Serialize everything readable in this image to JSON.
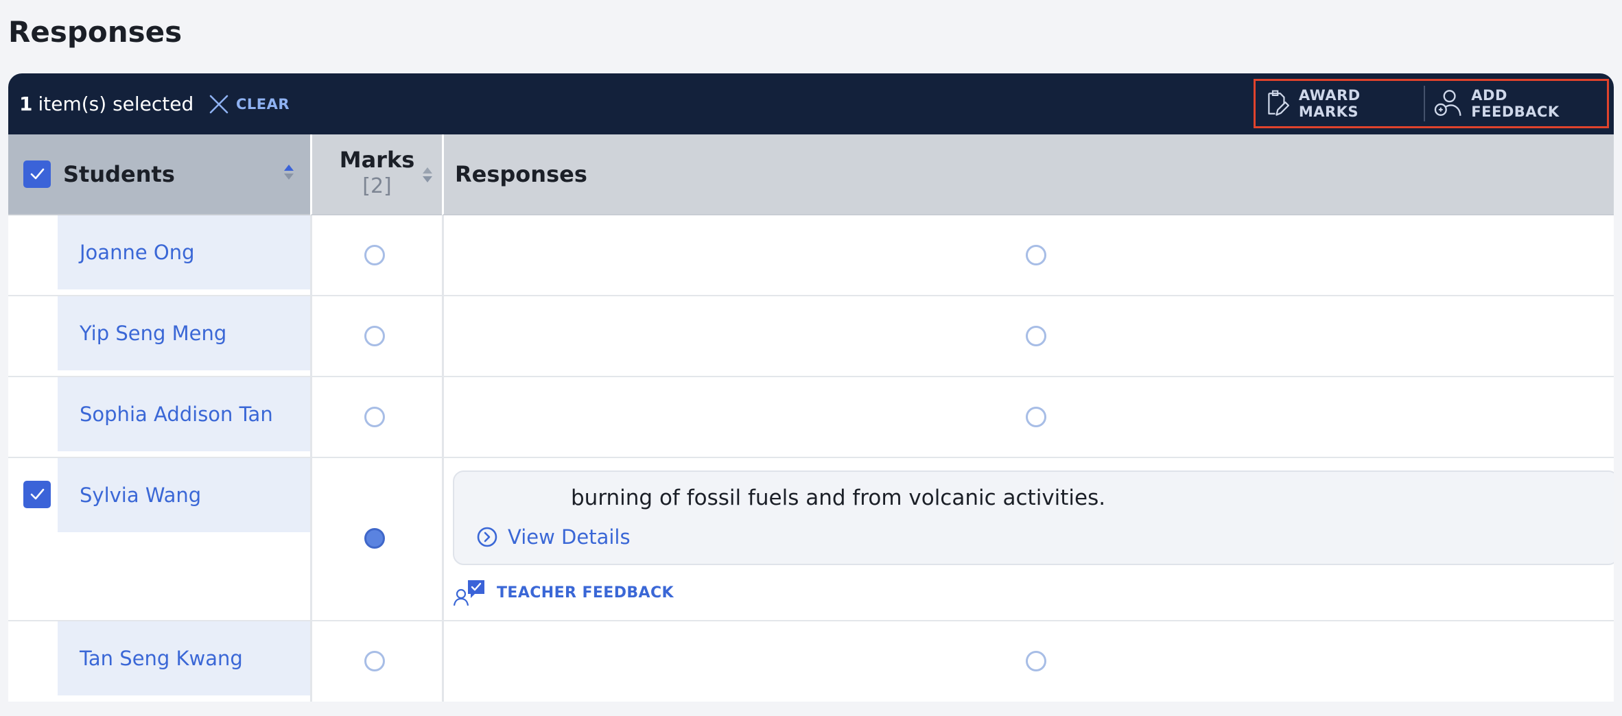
{
  "page": {
    "title": "Responses"
  },
  "selection_bar": {
    "count": "1",
    "count_suffix": "item(s) selected",
    "clear_label": "CLEAR",
    "award_marks_label": "AWARD MARKS",
    "add_feedback_label": "ADD FEEDBACK"
  },
  "table": {
    "headers": {
      "students": "Students",
      "marks": "Marks",
      "marks_sub": "[2]",
      "responses": "Responses"
    },
    "rows": [
      {
        "student": "Joanne Ong",
        "selected": false
      },
      {
        "student": "Yip Seng Meng",
        "selected": false
      },
      {
        "student": "Sophia Addison Tan",
        "selected": false
      },
      {
        "student": "Sylvia Wang",
        "selected": true,
        "response_text": "burning of fossil fuels and from volcanic activities.",
        "view_details_label": "View Details",
        "teacher_feedback_label": "TEACHER FEEDBACK"
      },
      {
        "student": "Tan Seng Kwang",
        "selected": false
      }
    ]
  },
  "colors": {
    "toolbar_bg": "#13213b",
    "accent": "#3b63d8",
    "link": "#3a67d6",
    "highlight_border": "#e0432c"
  },
  "icons": [
    "close-icon",
    "award-marks-icon",
    "add-feedback-icon",
    "check-icon",
    "sort-icon",
    "chevron-right-circle-icon",
    "teacher-feedback-icon"
  ]
}
